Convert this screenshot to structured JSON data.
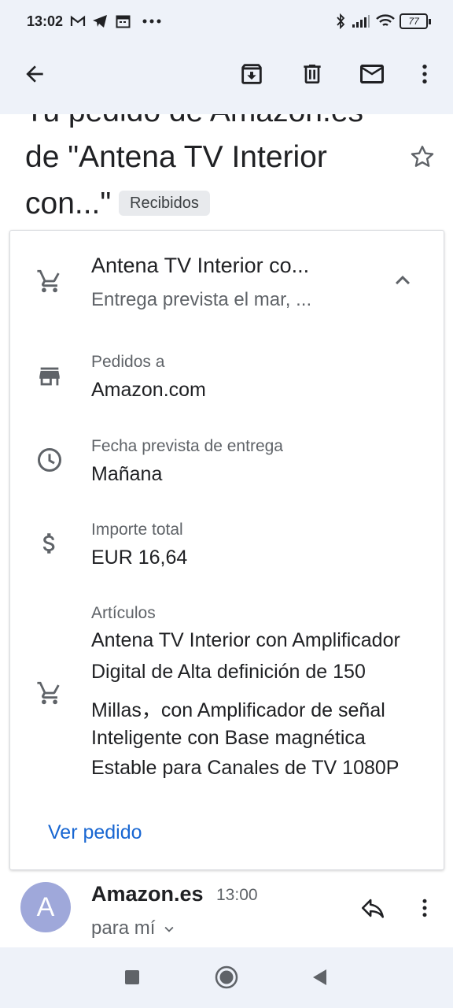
{
  "status_bar": {
    "time": "13:02",
    "battery": "77",
    "icons": [
      "gmail-icon",
      "telegram-icon",
      "calendar-icon",
      "more-dots-icon",
      "bluetooth-icon",
      "signal-icon",
      "wifi-icon",
      "battery-icon"
    ]
  },
  "toolbar": {
    "icons": [
      "back-arrow-icon",
      "archive-icon",
      "delete-icon",
      "mark-unread-icon",
      "more-vert-icon"
    ]
  },
  "subject": {
    "line1": "Tu pedido de Amazon.es",
    "line2": "de \"Antena TV Interior",
    "line3": "con...\"",
    "label": "Recibidos"
  },
  "order_card": {
    "title": "Antena TV Interior co...",
    "subtitle": "Entrega prevista el mar, ...",
    "rows": [
      {
        "label": "Pedidos a",
        "value": "Amazon.com",
        "icon": "store-icon"
      },
      {
        "label": "Fecha prevista de entrega",
        "value": "Mañana",
        "icon": "clock-icon"
      },
      {
        "label": "Importe total",
        "value": "EUR 16,64",
        "icon": "dollar-icon"
      }
    ],
    "items_label": "Artículos",
    "items_lines": [
      "Antena TV Interior con Amplificador",
      "Digital de Alta definición de 150",
      "Millas，con Amplificador de señal",
      "Inteligente con Base magnética",
      "Estable para Canales de TV 1080P"
    ],
    "view_order": "Ver pedido"
  },
  "message": {
    "avatar_letter": "A",
    "sender": "Amazon.es",
    "time": "13:00",
    "to": "para mí"
  },
  "colors": {
    "top_bar": "#eef2f9",
    "link": "#1967d2",
    "avatar": "#9fa8da"
  }
}
